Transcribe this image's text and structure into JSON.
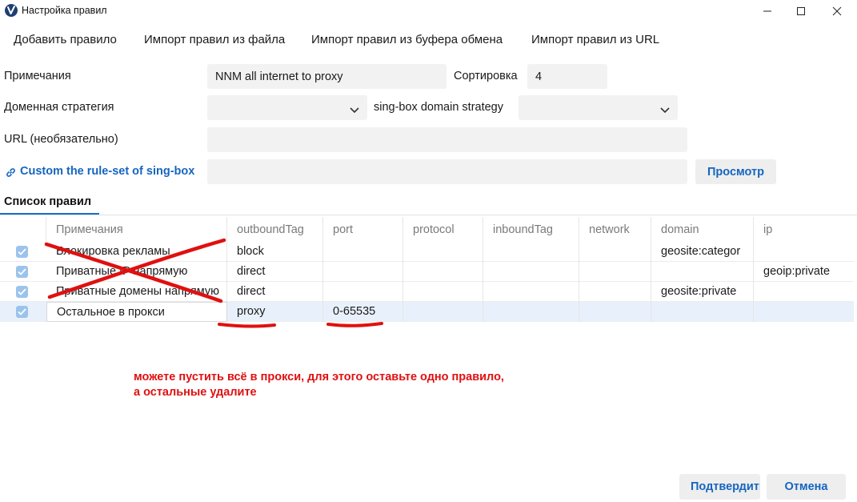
{
  "window": {
    "title": "Настройка правил",
    "controls": [
      "minimize-icon",
      "maximize-icon",
      "close-icon"
    ]
  },
  "menu": {
    "items": [
      "Добавить правило",
      "Импорт правил из файла",
      "Импорт правил из буфера обмена",
      "Импорт правил из URL"
    ]
  },
  "form": {
    "remarks_label": "Примечания",
    "remarks_value": "NNM all internet to proxy",
    "sort_label": "Сортировка",
    "sort_value": "4",
    "domain_strategy_label": "Доменная стратегия",
    "domain_strategy_value": "",
    "singbox_strategy_label": "sing-box domain strategy",
    "singbox_strategy_value": "",
    "url_label": "URL (необязательно)",
    "url_value": "",
    "ruleset_link": "Custom the rule-set of sing-box",
    "ruleset_value": "",
    "view_button": "Просмотр"
  },
  "tab": {
    "label": "Список правил"
  },
  "table": {
    "columns": [
      "Примечания",
      "outboundTag",
      "port",
      "protocol",
      "inboundTag",
      "network",
      "domain",
      "ip"
    ],
    "rows": [
      {
        "checked": true,
        "cells": [
          "Блокировка рекламы",
          "block",
          "",
          "",
          "",
          "",
          "geosite:categor",
          ""
        ]
      },
      {
        "checked": true,
        "cells": [
          "Приватные IP напрямую",
          "direct",
          "",
          "",
          "",
          "",
          "",
          "geoip:private"
        ]
      },
      {
        "checked": true,
        "cells": [
          "Приватные домены напрямую",
          "direct",
          "",
          "",
          "",
          "",
          "geosite:private",
          ""
        ]
      },
      {
        "checked": true,
        "cells": [
          "Остальное в прокси",
          "proxy",
          "0-65535",
          "",
          "",
          "",
          "",
          ""
        ],
        "selected": true
      }
    ]
  },
  "annotation": {
    "line1": "можете пустить всё в прокси, для этого оставьте одно правило,",
    "line2": "а остальные удалите",
    "color": "#e01010"
  },
  "buttons": {
    "confirm": "Подтвердить",
    "cancel": "Отмена"
  },
  "colors": {
    "accent": "#1565c0",
    "annotation_red": "#e01010",
    "field_bg": "#f2f2f2"
  }
}
